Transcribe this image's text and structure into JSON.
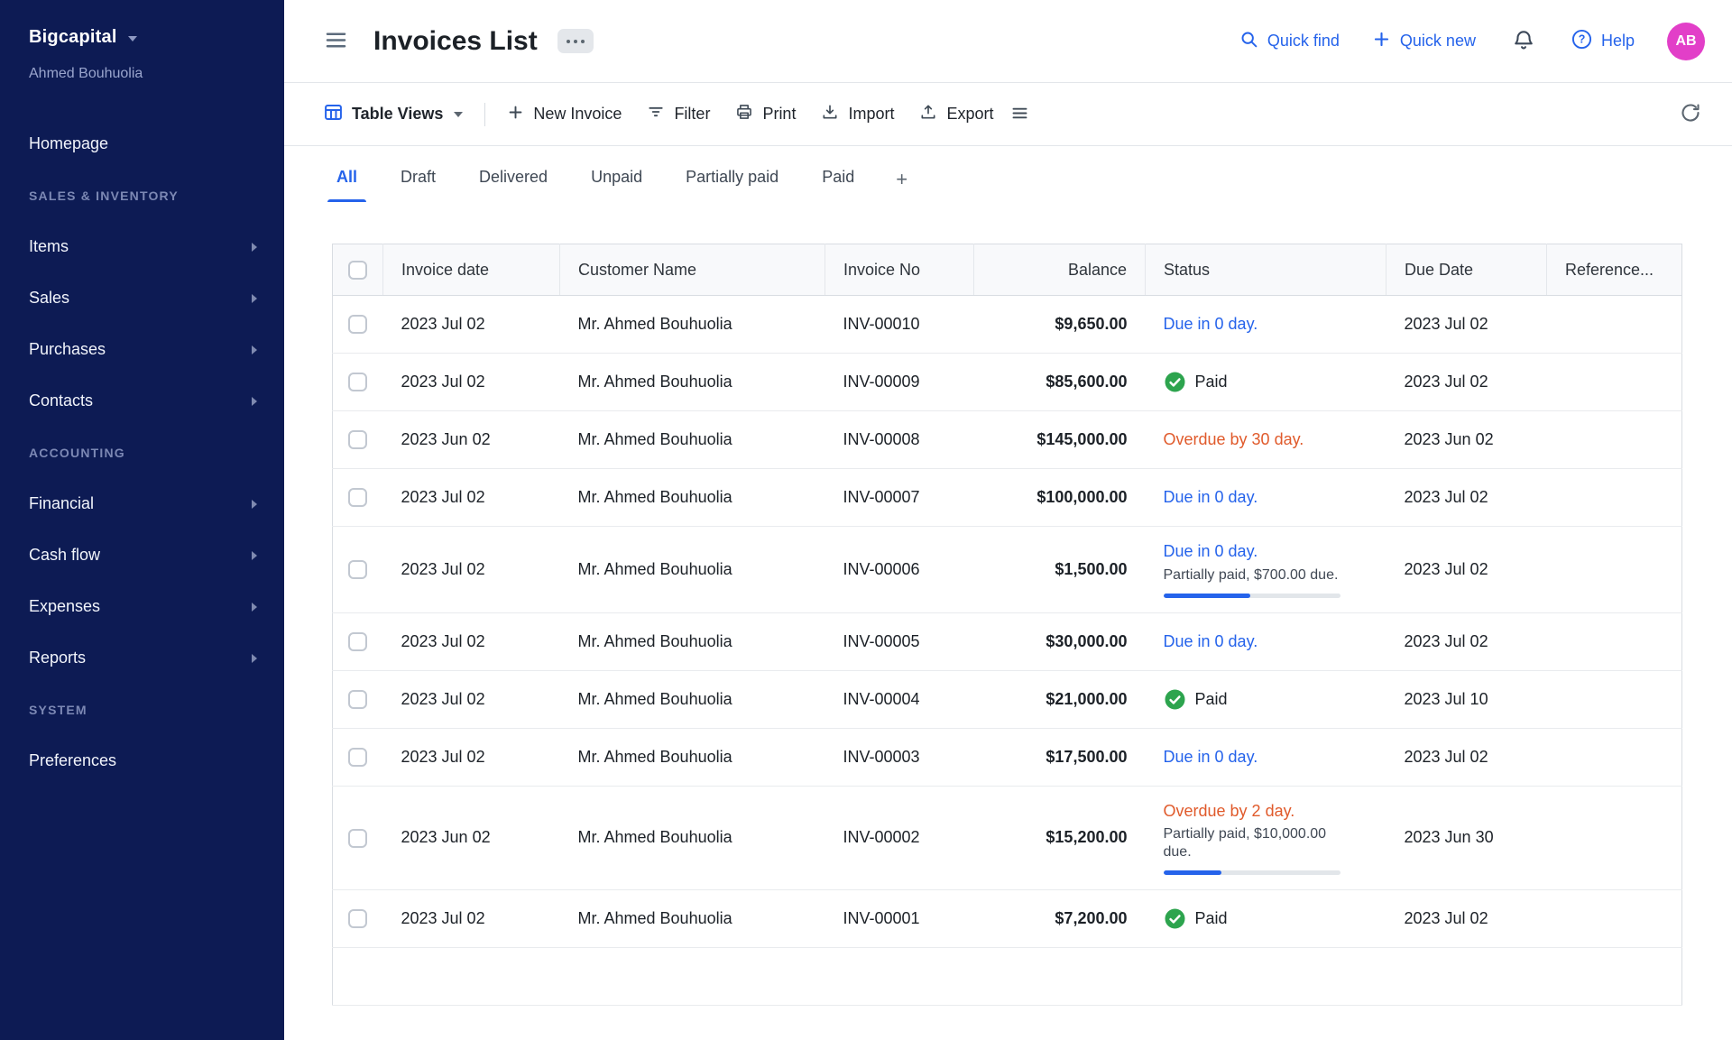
{
  "colors": {
    "sidebar_bg": "#0d1b54",
    "accent_blue": "#2563eb",
    "overdue_orange": "#e05a2b",
    "paid_green": "#2da44e",
    "avatar_bg": "#e23fc8"
  },
  "sidebar": {
    "brand": "Bigcapital",
    "user": "Ahmed Bouhuolia",
    "items": [
      {
        "label": "Homepage",
        "type": "link"
      },
      {
        "label": "SALES & INVENTORY",
        "type": "section"
      },
      {
        "label": "Items",
        "type": "expandable"
      },
      {
        "label": "Sales",
        "type": "expandable"
      },
      {
        "label": "Purchases",
        "type": "expandable"
      },
      {
        "label": "Contacts",
        "type": "expandable"
      },
      {
        "label": "ACCOUNTING",
        "type": "section"
      },
      {
        "label": "Financial",
        "type": "expandable"
      },
      {
        "label": "Cash flow",
        "type": "expandable"
      },
      {
        "label": "Expenses",
        "type": "expandable"
      },
      {
        "label": "Reports",
        "type": "expandable"
      },
      {
        "label": "SYSTEM",
        "type": "section"
      },
      {
        "label": "Preferences",
        "type": "link"
      }
    ]
  },
  "header": {
    "title": "Invoices List",
    "quick_find_label": "Quick find",
    "quick_new_label": "Quick new",
    "help_label": "Help",
    "avatar_initials": "AB"
  },
  "toolbar": {
    "table_views_label": "Table Views",
    "new_invoice_label": "New Invoice",
    "filter_label": "Filter",
    "print_label": "Print",
    "import_label": "Import",
    "export_label": "Export"
  },
  "tabs": {
    "items": [
      {
        "label": "All",
        "active": true
      },
      {
        "label": "Draft",
        "active": false
      },
      {
        "label": "Delivered",
        "active": false
      },
      {
        "label": "Unpaid",
        "active": false
      },
      {
        "label": "Partially paid",
        "active": false
      },
      {
        "label": "Paid",
        "active": false
      }
    ],
    "add_label": "+"
  },
  "table": {
    "columns": [
      "Invoice date",
      "Customer Name",
      "Invoice No",
      "Balance",
      "Status",
      "Due Date",
      "Reference..."
    ],
    "rows": [
      {
        "invoice_date": "2023 Jul 02",
        "customer_name": "Mr. Ahmed Bouhuolia",
        "invoice_no": "INV-00010",
        "balance": "$9,650.00",
        "due_date": "2023 Jul 02",
        "reference": "",
        "status": {
          "kind": "due",
          "text": "Due in 0 day."
        }
      },
      {
        "invoice_date": "2023 Jul 02",
        "customer_name": "Mr. Ahmed Bouhuolia",
        "invoice_no": "INV-00009",
        "balance": "$85,600.00",
        "due_date": "2023 Jul 02",
        "reference": "",
        "status": {
          "kind": "paid",
          "text": "Paid"
        }
      },
      {
        "invoice_date": "2023 Jun 02",
        "customer_name": "Mr. Ahmed Bouhuolia",
        "invoice_no": "INV-00008",
        "balance": "$145,000.00",
        "due_date": "2023 Jun 02",
        "reference": "",
        "status": {
          "kind": "overdue",
          "text": "Overdue by 30 day."
        }
      },
      {
        "invoice_date": "2023 Jul 02",
        "customer_name": "Mr. Ahmed Bouhuolia",
        "invoice_no": "INV-00007",
        "balance": "$100,000.00",
        "due_date": "2023 Jul 02",
        "reference": "",
        "status": {
          "kind": "due",
          "text": "Due in 0 day."
        }
      },
      {
        "invoice_date": "2023 Jul 02",
        "customer_name": "Mr. Ahmed Bouhuolia",
        "invoice_no": "INV-00006",
        "balance": "$1,500.00",
        "due_date": "2023 Jul 02",
        "reference": "",
        "status": {
          "kind": "due",
          "text": "Due in 0 day.",
          "partial_text": "Partially paid, $700.00 due.",
          "progress_pct": 49
        }
      },
      {
        "invoice_date": "2023 Jul 02",
        "customer_name": "Mr. Ahmed Bouhuolia",
        "invoice_no": "INV-00005",
        "balance": "$30,000.00",
        "due_date": "2023 Jul 02",
        "reference": "",
        "status": {
          "kind": "due",
          "text": "Due in 0 day."
        }
      },
      {
        "invoice_date": "2023 Jul 02",
        "customer_name": "Mr. Ahmed Bouhuolia",
        "invoice_no": "INV-00004",
        "balance": "$21,000.00",
        "due_date": "2023 Jul 10",
        "reference": "",
        "status": {
          "kind": "paid",
          "text": "Paid"
        }
      },
      {
        "invoice_date": "2023 Jul 02",
        "customer_name": "Mr. Ahmed Bouhuolia",
        "invoice_no": "INV-00003",
        "balance": "$17,500.00",
        "due_date": "2023 Jul 02",
        "reference": "",
        "status": {
          "kind": "due",
          "text": "Due in 0 day."
        }
      },
      {
        "invoice_date": "2023 Jun 02",
        "customer_name": "Mr. Ahmed Bouhuolia",
        "invoice_no": "INV-00002",
        "balance": "$15,200.00",
        "due_date": "2023 Jun 30",
        "reference": "",
        "status": {
          "kind": "overdue",
          "text": "Overdue by 2 day.",
          "partial_text": "Partially paid, $10,000.00 due.",
          "progress_pct": 33
        }
      },
      {
        "invoice_date": "2023 Jul 02",
        "customer_name": "Mr. Ahmed Bouhuolia",
        "invoice_no": "INV-00001",
        "balance": "$7,200.00",
        "due_date": "2023 Jul 02",
        "reference": "",
        "status": {
          "kind": "paid",
          "text": "Paid"
        }
      }
    ]
  }
}
